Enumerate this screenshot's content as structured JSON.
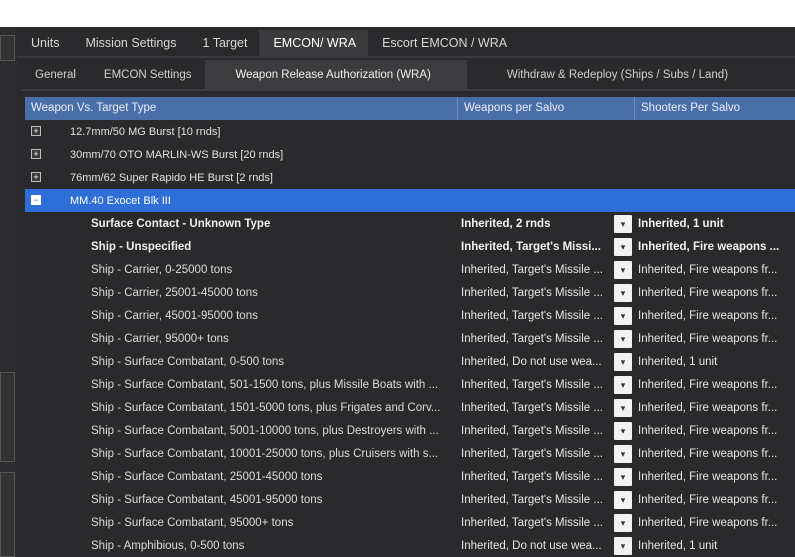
{
  "top_tabs": [
    "Units",
    "Mission Settings",
    "1 Target",
    "EMCON/ WRA",
    "Escort EMCON / WRA"
  ],
  "sub_tabs": [
    "General",
    "EMCON Settings",
    "Weapon Release Authorization (WRA)",
    "Withdraw & Redeploy (Ships / Subs / Land)"
  ],
  "columns": [
    "Weapon Vs. Target Type",
    "Weapons per Salvo",
    "Shooters Per Salvo"
  ],
  "groups": [
    {
      "label": "12.7mm/50 MG Burst [10 rnds]",
      "expander": "+"
    },
    {
      "label": "30mm/70 OTO MARLIN-WS Burst [20 rnds]",
      "expander": "+"
    },
    {
      "label": "76mm/62 Super Rapido HE Burst [2 rnds]",
      "expander": "+"
    },
    {
      "label": "MM.40 Exocet Blk III",
      "expander": "−"
    }
  ],
  "rows": [
    {
      "target": "Surface Contact - Unknown Type",
      "weapons": "Inherited, 2 rnds",
      "shooters": "Inherited, 1 unit"
    },
    {
      "target": "Ship - Unspecified",
      "weapons": "Inherited, Target's Missi...",
      "shooters": "Inherited, Fire weapons ..."
    },
    {
      "target": "Ship - Carrier, 0-25000 tons",
      "weapons": "Inherited, Target's Missile ...",
      "shooters": "Inherited, Fire weapons fr..."
    },
    {
      "target": "Ship - Carrier, 25001-45000 tons",
      "weapons": "Inherited, Target's Missile ...",
      "shooters": "Inherited, Fire weapons fr..."
    },
    {
      "target": "Ship - Carrier, 45001-95000 tons",
      "weapons": "Inherited, Target's Missile ...",
      "shooters": "Inherited, Fire weapons fr..."
    },
    {
      "target": "Ship - Carrier, 95000+ tons",
      "weapons": "Inherited, Target's Missile ...",
      "shooters": "Inherited, Fire weapons fr..."
    },
    {
      "target": "Ship - Surface Combatant, 0-500 tons",
      "weapons": "Inherited, Do not use wea...",
      "shooters": "Inherited, 1 unit"
    },
    {
      "target": "Ship - Surface Combatant, 501-1500 tons, plus Missile Boats with ...",
      "weapons": "Inherited, Target's Missile ...",
      "shooters": "Inherited, Fire weapons fr..."
    },
    {
      "target": "Ship - Surface Combatant, 1501-5000 tons, plus Frigates and Corv...",
      "weapons": "Inherited, Target's Missile ...",
      "shooters": "Inherited, Fire weapons fr..."
    },
    {
      "target": "Ship - Surface Combatant, 5001-10000 tons, plus Destroyers with ...",
      "weapons": "Inherited, Target's Missile ...",
      "shooters": "Inherited, Fire weapons fr..."
    },
    {
      "target": "Ship - Surface Combatant, 10001-25000 tons, plus Cruisers with s...",
      "weapons": "Inherited, Target's Missile ...",
      "shooters": "Inherited, Fire weapons fr..."
    },
    {
      "target": "Ship - Surface Combatant, 25001-45000 tons",
      "weapons": "Inherited, Target's Missile ...",
      "shooters": "Inherited, Fire weapons fr..."
    },
    {
      "target": "Ship - Surface Combatant, 45001-95000 tons",
      "weapons": "Inherited, Target's Missile ...",
      "shooters": "Inherited, Fire weapons fr..."
    },
    {
      "target": "Ship - Surface Combatant, 95000+ tons",
      "weapons": "Inherited, Target's Missile ...",
      "shooters": "Inherited, Fire weapons fr..."
    },
    {
      "target": "Ship - Amphibious, 0-500 tons",
      "weapons": "Inherited, Do not use wea...",
      "shooters": "Inherited, 1 unit"
    }
  ],
  "dropdown_icon": "chevron-down-icon",
  "colors": {
    "header": "#4a6fa8",
    "selected": "#2d6fd6",
    "background": "#2a2a2c"
  }
}
